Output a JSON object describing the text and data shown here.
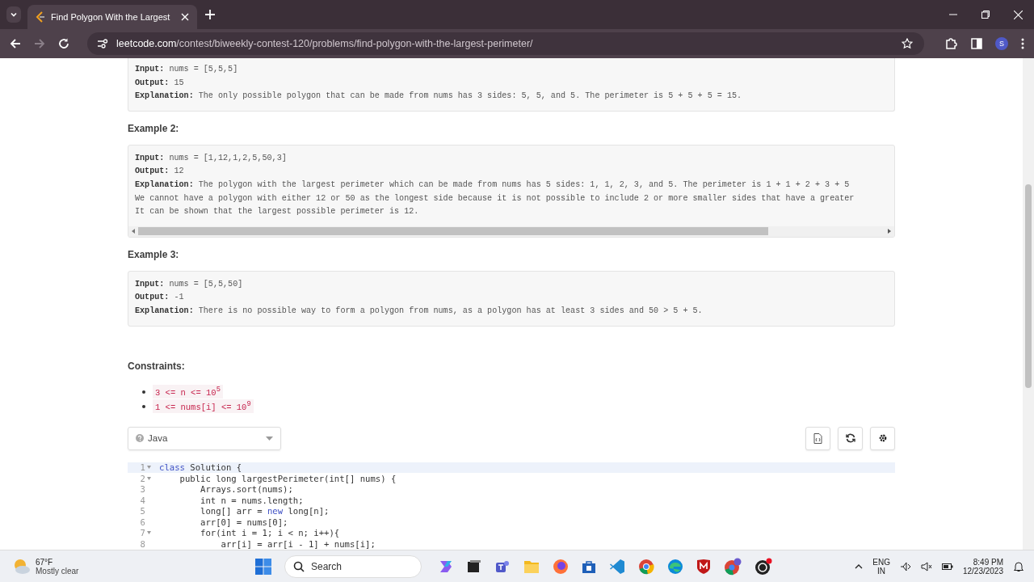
{
  "browser": {
    "tab": {
      "title": "Find Polygon With the Largest",
      "selected": true
    },
    "url_domain": "leetcode.com",
    "url_path": "/contest/biweekly-contest-120/problems/find-polygon-with-the-largest-perimeter/",
    "profile_initial": "S"
  },
  "examples": [
    {
      "lines": [
        {
          "label": "Input:",
          "text": " nums = [5,5,5]"
        },
        {
          "label": "Output:",
          "text": " 15"
        },
        {
          "label": "Explanation:",
          "text": " The only possible polygon that can be made from nums has 3 sides: 5, 5, and 5. The perimeter is 5 + 5 + 5 = 15."
        }
      ],
      "scrollable": false
    },
    {
      "heading": "Example 2:",
      "lines": [
        {
          "label": "Input:",
          "text": " nums = [1,12,1,2,5,50,3]"
        },
        {
          "label": "Output:",
          "text": " 12"
        },
        {
          "label": "Explanation:",
          "text": " The polygon with the largest perimeter which can be made from nums has 5 sides: 1, 1, 2, 3, and 5. The perimeter is 1 + 1 + 2 + 3 + 5"
        },
        {
          "text": "We cannot have a polygon with either 12 or 50 as the longest side because it is not possible to include 2 or more smaller sides that have a greater"
        },
        {
          "text": "It can be shown that the largest possible perimeter is 12."
        }
      ],
      "scrollable": true
    },
    {
      "heading": "Example 3:",
      "lines": [
        {
          "label": "Input:",
          "text": " nums = [5,5,50]"
        },
        {
          "label": "Output:",
          "text": " -1"
        },
        {
          "label": "Explanation:",
          "text": " There is no possible way to form a polygon from nums, as a polygon has at least 3 sides and 50 > 5 + 5."
        }
      ],
      "scrollable": false
    }
  ],
  "constraints": {
    "heading": "Constraints:",
    "items": [
      "3 <= n <= 10$^{5}$",
      "1 <= nums[i] <= 10$^{9}$"
    ]
  },
  "editor": {
    "language": "Java",
    "lines": [
      {
        "n": "1",
        "fold": true,
        "active": true,
        "segments": [
          {
            "t": "class",
            "kind": "keyword"
          },
          {
            "t": " Solution {",
            "kind": "plain"
          }
        ]
      },
      {
        "n": "2",
        "fold": true,
        "active": false,
        "segments": [
          {
            "t": "    public long largestPerimeter(int[] nums) {",
            "kind": "plain"
          }
        ]
      },
      {
        "n": "3",
        "fold": false,
        "active": false,
        "segments": [
          {
            "t": "        Arrays.sort(nums);",
            "kind": "plain"
          }
        ]
      },
      {
        "n": "4",
        "fold": false,
        "active": false,
        "segments": [
          {
            "t": "        int n = nums.length;",
            "kind": "plain"
          }
        ]
      },
      {
        "n": "5",
        "fold": false,
        "active": false,
        "segments": [
          {
            "t": "        long[] arr = ",
            "kind": "plain"
          },
          {
            "t": "new",
            "kind": "keyword"
          },
          {
            "t": " long[n];",
            "kind": "plain"
          }
        ]
      },
      {
        "n": "6",
        "fold": false,
        "active": false,
        "segments": [
          {
            "t": "        arr[0] = nums[0];",
            "kind": "plain"
          }
        ]
      },
      {
        "n": "7",
        "fold": true,
        "active": false,
        "segments": [
          {
            "t": "        for(int i = 1; i < n; i++){",
            "kind": "plain"
          }
        ]
      },
      {
        "n": "8",
        "fold": false,
        "active": false,
        "segments": [
          {
            "t": "            arr[i] = arr[i - 1] + nums[i];",
            "kind": "plain"
          }
        ]
      }
    ]
  },
  "taskbar": {
    "temperature": "67°F",
    "weather": "Mostly clear",
    "search_placeholder": "Search",
    "language": "ENG",
    "region": "IN",
    "time": "8:49 PM",
    "date": "12/23/2023"
  }
}
